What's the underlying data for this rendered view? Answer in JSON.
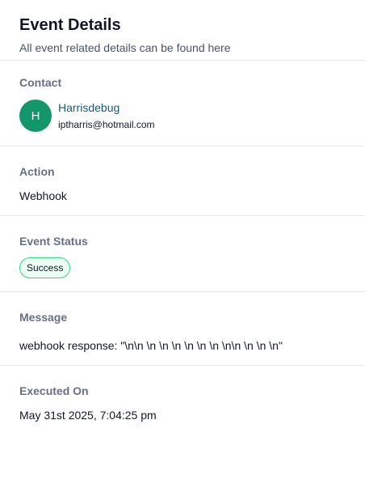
{
  "header": {
    "title": "Event Details",
    "subtitle": "All event related details can be found here"
  },
  "contact": {
    "label": "Contact",
    "avatar_initial": "H",
    "avatar_color": "#12966a",
    "name": "Harrisdebug",
    "email": "iptharris@hotmail.com"
  },
  "action": {
    "label": "Action",
    "value": "Webhook"
  },
  "status": {
    "label": "Event Status",
    "value": "Success",
    "color": "#32d583"
  },
  "message": {
    "label": "Message",
    "value": "webhook response: \"\\n\\n \\n \\n \\n \\n \\n \\n \\n\\n \\n \\n \\n\""
  },
  "executed": {
    "label": "Executed On",
    "value": "May 31st 2025, 7:04:25 pm"
  }
}
